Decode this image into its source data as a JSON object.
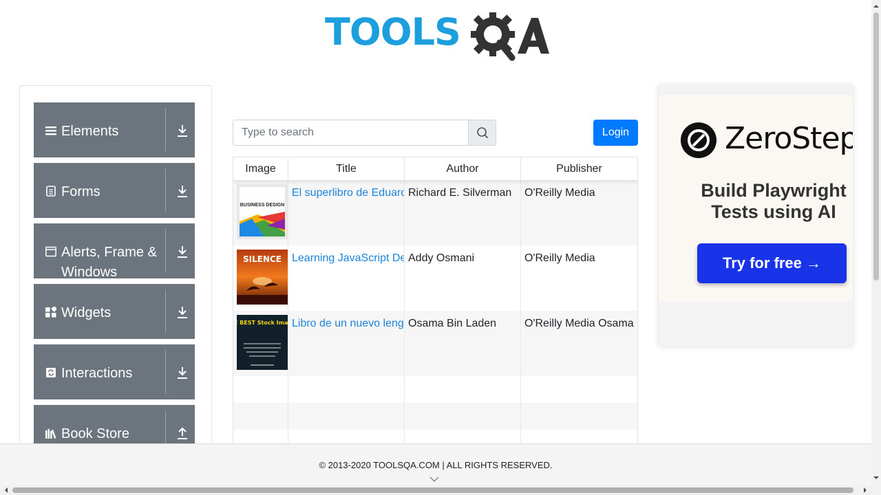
{
  "header": {
    "logo_text": "TOOLSQA",
    "logo_part1": "TOOLS",
    "logo_part2": "QA"
  },
  "sidebar": {
    "groups": [
      {
        "label": "Elements",
        "icon": "hamburger-icon",
        "toggle": "download-arrow-icon"
      },
      {
        "label": "Forms",
        "icon": "document-icon",
        "toggle": "download-arrow-icon"
      },
      {
        "label": "Alerts, Frame & Windows",
        "icon": "window-icon",
        "toggle": "download-arrow-icon"
      },
      {
        "label": "Widgets",
        "icon": "widgets-icon",
        "toggle": "download-arrow-icon"
      },
      {
        "label": "Interactions",
        "icon": "refresh-icon",
        "toggle": "download-arrow-icon"
      },
      {
        "label": "Book Store",
        "icon": "books-icon",
        "toggle": "upload-arrow-icon"
      }
    ]
  },
  "search": {
    "placeholder": "Type to search",
    "value": ""
  },
  "login": {
    "label": "Login",
    "color": "#007bff"
  },
  "table": {
    "headers": [
      "Image",
      "Title",
      "Author",
      "Publisher"
    ],
    "rows": [
      {
        "title": "El superlibro de Eduardo",
        "author": "Richard E. Silverman",
        "publisher": "O'Reilly Media",
        "cover": "business-design-cover",
        "cover_text": "BUSINESS DESIGN"
      },
      {
        "title": "Learning JavaScript Design Patterns",
        "author": "Addy Osmani",
        "publisher": "O'Reilly Media",
        "cover": "silence-cover",
        "cover_text": "SILENCE"
      },
      {
        "title": "Libro de un nuevo lenguaje",
        "author": "Osama Bin Laden",
        "publisher": "O'Reilly Media Osama",
        "cover": "best-stock-images-cover",
        "cover_text": "THE BEST Stock Images"
      }
    ]
  },
  "ad": {
    "brand": "ZeroStep",
    "headline_line1": "Build Playwright",
    "headline_line2": "Tests using AI",
    "cta": "Try for free →",
    "cta_color": "#1833e8"
  },
  "footer": {
    "text": "© 2013-2020 TOOLSQA.COM | ALL RIGHTS RESERVED."
  },
  "colors": {
    "sidebar_group": "#6c757d",
    "link": "#1c84da",
    "logo_blue": "#1c9fdc"
  }
}
